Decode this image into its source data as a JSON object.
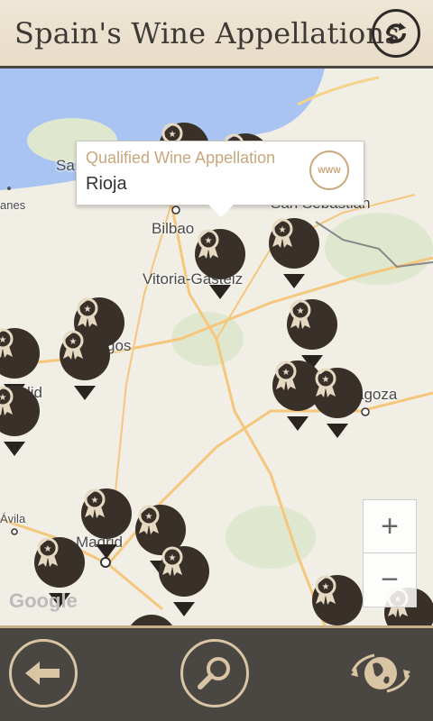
{
  "header": {
    "title": "Spain's Wine Appellations",
    "refresh_icon": "refresh-icon"
  },
  "map": {
    "places": {
      "bilbao": "Bilbao",
      "vitoria": "Vitoria-Gasteiz",
      "san_sebastian": "San Sebastián",
      "burgos": "gos",
      "zaragoza": "agoza",
      "madrid": "Madrid",
      "avila": "Ávila",
      "valladolid": "lid",
      "santander": "Sa",
      "llanes": "anes"
    },
    "popup": {
      "type": "Qualified Wine Appellation",
      "name": "Rioja",
      "icon": "www-globe-icon",
      "icon_text": "WWW"
    },
    "zoom_in": "+",
    "zoom_out": "−",
    "attribution": "Google"
  },
  "footer": {
    "back_icon": "back-arrow-icon",
    "search_icon": "search-icon",
    "globe_icon": "globe-icon"
  },
  "colors": {
    "accent": "#c9a77c",
    "dark": "#3a302a",
    "bar": "#4a4743"
  }
}
